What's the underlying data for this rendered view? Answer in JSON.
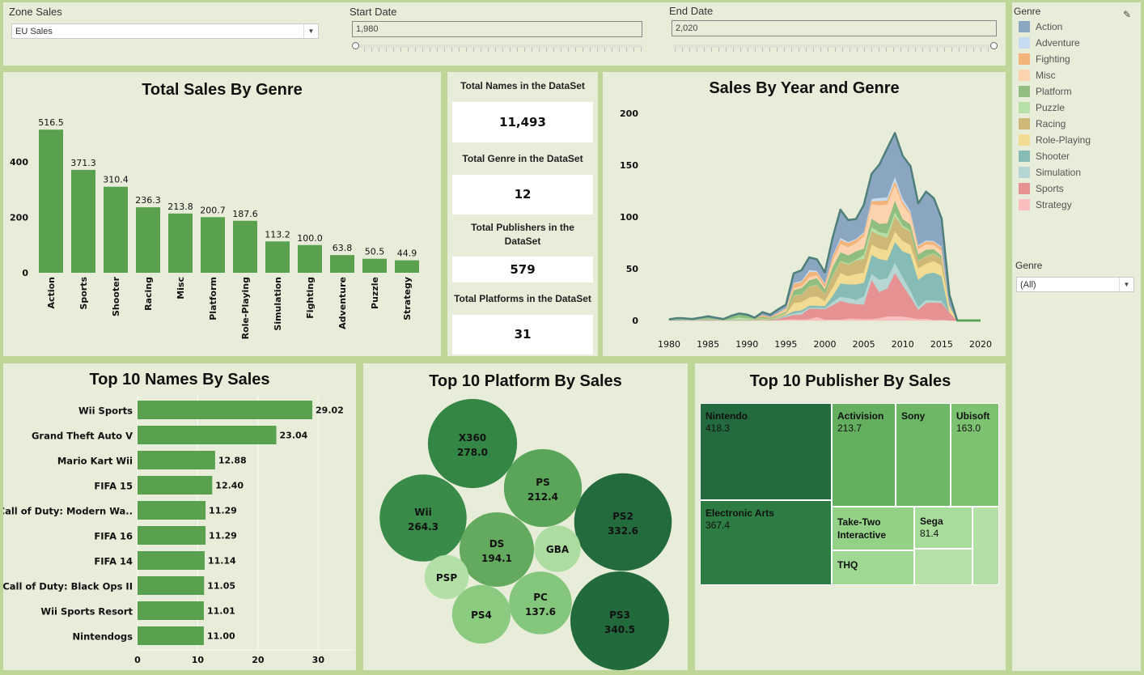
{
  "filters": {
    "zone_sales": {
      "label": "Zone Sales",
      "value": "EU Sales"
    },
    "start_date": {
      "label": "Start Date",
      "value": "1,980",
      "fraction": 0.0
    },
    "end_date": {
      "label": "End Date",
      "value": "2,020",
      "fraction": 1.0
    }
  },
  "legend": {
    "title": "Genre",
    "items": [
      {
        "label": "Action",
        "color": "#8aa6c1"
      },
      {
        "label": "Adventure",
        "color": "#c6dbef"
      },
      {
        "label": "Fighting",
        "color": "#f3b47a"
      },
      {
        "label": "Misc",
        "color": "#fdd3ad"
      },
      {
        "label": "Platform",
        "color": "#8fbe80"
      },
      {
        "label": "Puzzle",
        "color": "#b6e0a7"
      },
      {
        "label": "Racing",
        "color": "#cdb878"
      },
      {
        "label": "Role-Playing",
        "color": "#f2dc93"
      },
      {
        "label": "Shooter",
        "color": "#86bbb6"
      },
      {
        "label": "Simulation",
        "color": "#b5d6d3"
      },
      {
        "label": "Sports",
        "color": "#e69192"
      },
      {
        "label": "Strategy",
        "color": "#f9bebe"
      }
    ]
  },
  "genre_filter": {
    "label": "Genre",
    "value": "(All)"
  },
  "kpis": [
    {
      "label": "Total Names in the DataSet",
      "value": "11,493"
    },
    {
      "label": "Total Genre in the DataSet",
      "value": "12"
    },
    {
      "label": "Total Publishers in the DataSet",
      "value": "579"
    },
    {
      "label": "Total Platforms in the DataSet",
      "value": "31"
    }
  ],
  "chart_data": [
    {
      "id": "genre_bar",
      "type": "bar",
      "title": "Total Sales By Genre",
      "categories": [
        "Action",
        "Sports",
        "Shooter",
        "Racing",
        "Misc",
        "Platform",
        "Role-Playing",
        "Simulation",
        "Fighting",
        "Adventure",
        "Puzzle",
        "Strategy"
      ],
      "values": [
        516.5,
        371.3,
        310.4,
        236.3,
        213.8,
        200.7,
        187.6,
        113.2,
        100.0,
        63.8,
        50.5,
        44.9
      ],
      "labels": [
        "516.5",
        "371.3",
        "310.4",
        "236.3",
        "213.8",
        "200.7",
        "187.6",
        "113.2",
        "100.0",
        "63.8",
        "50.5",
        "44.9"
      ],
      "yticks": [
        0,
        200,
        400
      ],
      "ylim": [
        0,
        520
      ],
      "color": "#59a14f",
      "xlabel": "",
      "ylabel": ""
    },
    {
      "id": "year_area",
      "type": "area",
      "title": "Sales By Year and Genre",
      "x": [
        1980,
        1981,
        1982,
        1983,
        1984,
        1985,
        1986,
        1987,
        1988,
        1989,
        1990,
        1991,
        1992,
        1993,
        1994,
        1995,
        1996,
        1997,
        1998,
        1999,
        2000,
        2001,
        2002,
        2003,
        2004,
        2005,
        2006,
        2007,
        2008,
        2009,
        2010,
        2011,
        2012,
        2013,
        2014,
        2015,
        2016,
        2017,
        2018,
        2019,
        2020
      ],
      "series": [
        {
          "name": "Strategy",
          "values": [
            0,
            0,
            0,
            0,
            0,
            0,
            0,
            0,
            0,
            0,
            0,
            0.2,
            0.2,
            0,
            0.5,
            1,
            1.5,
            1,
            1.5,
            3.5,
            1,
            1,
            1,
            2,
            2,
            1.5,
            1.5,
            2.5,
            4,
            4,
            4,
            3,
            1.5,
            2,
            0.5,
            1,
            0,
            0,
            0,
            0,
            0
          ]
        },
        {
          "name": "Sports",
          "values": [
            0.2,
            0.3,
            0.3,
            0.3,
            0.4,
            0.4,
            0.4,
            0.2,
            0.3,
            0.5,
            0.3,
            0.3,
            0.3,
            0.3,
            1,
            2.5,
            4,
            5,
            10,
            8,
            10,
            14,
            18,
            15,
            14,
            14,
            38,
            25,
            27,
            42,
            30,
            20,
            9,
            15,
            17,
            16,
            8,
            0,
            0,
            0,
            0
          ]
        },
        {
          "name": "Simulation",
          "values": [
            0,
            0,
            0,
            0,
            0,
            0,
            0,
            0,
            0,
            0,
            0,
            0,
            0,
            0,
            0.5,
            1,
            1.5,
            2,
            1,
            1,
            1,
            3,
            4,
            5,
            4,
            8,
            6,
            12,
            10,
            10,
            8,
            6,
            3,
            3,
            2,
            2,
            0,
            0,
            0,
            0,
            0
          ]
        },
        {
          "name": "Shooter",
          "values": [
            0.5,
            0.8,
            0.5,
            0.2,
            0.5,
            0.5,
            0.3,
            0.2,
            0.3,
            0.3,
            0.2,
            0.3,
            0.3,
            0.3,
            0.5,
            1,
            2,
            2,
            2,
            2,
            2,
            6,
            13,
            13,
            15,
            13,
            18,
            20,
            17,
            20,
            25,
            35,
            26,
            25,
            27,
            24,
            0,
            0,
            0,
            0,
            0
          ]
        },
        {
          "name": "Role-Playing",
          "values": [
            0,
            0,
            0,
            0,
            0,
            0,
            0,
            0,
            0,
            0,
            0,
            0,
            0.5,
            0,
            0.5,
            1,
            8,
            8,
            8,
            9,
            5,
            8,
            10,
            8,
            10,
            10,
            10,
            10,
            10,
            10,
            10,
            9,
            11,
            10,
            11,
            10,
            7,
            0,
            0,
            0,
            0
          ]
        },
        {
          "name": "Racing",
          "values": [
            0,
            0,
            0,
            0,
            0.2,
            0.2,
            0.2,
            0,
            0,
            0,
            0.2,
            0.5,
            0.5,
            0.5,
            1,
            1,
            7,
            7,
            10,
            11,
            7,
            11,
            11,
            11,
            13,
            13,
            13,
            13,
            12,
            15,
            13,
            13,
            7,
            7,
            7,
            7,
            0,
            0,
            0,
            0,
            0
          ]
        },
        {
          "name": "Puzzle",
          "values": [
            0,
            0.3,
            0.3,
            0.2,
            0.3,
            0.5,
            0.3,
            0.2,
            1,
            2.5,
            1.5,
            0.5,
            0.5,
            0.5,
            0.5,
            0.5,
            0.5,
            0.5,
            0.5,
            0.5,
            0.5,
            1,
            1,
            1,
            1,
            4,
            4,
            3,
            4,
            4,
            2,
            1,
            0.5,
            0.5,
            0.5,
            0.5,
            0,
            0,
            0,
            0,
            0
          ]
        },
        {
          "name": "Platform",
          "values": [
            0,
            0.2,
            0.3,
            0.3,
            0.5,
            1.5,
            0.5,
            0.3,
            2.5,
            3,
            3,
            0.5,
            1.5,
            1,
            1,
            1,
            5,
            6,
            6,
            6,
            4,
            8,
            8,
            8,
            8,
            6,
            8,
            8,
            10,
            11,
            6,
            6,
            6,
            6,
            4,
            2,
            0,
            0,
            0,
            0,
            0
          ]
        },
        {
          "name": "Misc",
          "values": [
            0,
            0,
            0,
            0,
            0,
            0,
            0,
            0,
            0,
            0,
            0,
            0,
            0,
            0,
            1,
            2,
            2,
            2,
            3,
            3,
            2,
            6,
            8,
            8,
            8,
            12,
            14,
            18,
            18,
            15,
            14,
            9,
            5,
            5,
            4,
            5,
            0,
            0,
            0,
            0,
            0
          ]
        },
        {
          "name": "Fighting",
          "values": [
            0,
            0,
            0,
            0,
            0,
            0,
            0,
            0,
            0,
            0,
            0,
            0,
            1.5,
            1,
            1,
            1,
            4,
            4,
            5,
            3,
            3,
            4,
            4,
            4,
            3,
            3,
            3,
            4,
            4,
            4,
            3,
            2,
            3,
            3,
            3,
            3,
            0,
            0,
            0,
            0,
            0
          ]
        },
        {
          "name": "Adventure",
          "values": [
            0,
            0,
            0,
            0,
            0,
            0,
            0,
            0,
            0,
            0,
            0,
            0,
            0.3,
            0,
            0.3,
            0.3,
            1,
            1,
            2,
            1,
            1,
            1,
            2,
            1,
            1,
            1,
            2,
            3,
            3,
            4,
            3,
            2,
            1,
            1,
            1,
            1,
            0,
            0,
            0,
            0,
            0
          ]
        },
        {
          "name": "Action",
          "values": [
            0.5,
            0.7,
            0.7,
            0.5,
            0.8,
            1,
            1,
            0.5,
            0.5,
            0.5,
            0.5,
            0.5,
            2.5,
            2,
            3,
            3,
            9,
            10,
            12,
            11,
            10,
            17,
            27,
            21,
            19,
            26,
            24,
            32,
            47,
            42,
            41,
            43,
            40,
            47,
            41,
            27,
            10,
            0,
            0,
            0,
            0
          ]
        }
      ],
      "yticks": [
        0,
        50,
        100,
        150,
        200
      ],
      "xticks": [
        1980,
        1985,
        1990,
        1995,
        2000,
        2005,
        2010,
        2015,
        2020
      ],
      "ylim": [
        0,
        200
      ],
      "xlim": [
        1980,
        2020
      ],
      "outline_color": "#4e7f7a",
      "baseline_color": "#59a14f",
      "xlabel": "",
      "ylabel": ""
    },
    {
      "id": "names_bar",
      "type": "bar",
      "orientation": "horizontal",
      "title": "Top 10 Names By Sales",
      "categories": [
        "Wii Sports",
        "Grand Theft Auto V",
        "Mario Kart Wii",
        "FIFA 15",
        "Call of Duty: Modern Wa..",
        "FIFA 16",
        "FIFA 14",
        "Call of Duty: Black Ops II",
        "Wii Sports Resort",
        "Nintendogs"
      ],
      "values": [
        29.02,
        23.04,
        12.88,
        12.4,
        11.29,
        11.29,
        11.14,
        11.05,
        11.01,
        11.0
      ],
      "labels": [
        "29.02",
        "23.04",
        "12.88",
        "12.40",
        "11.29",
        "11.29",
        "11.14",
        "11.05",
        "11.01",
        "11.00"
      ],
      "xticks": [
        0,
        10,
        20,
        30
      ],
      "xlim": [
        0,
        36
      ],
      "color": "#59a14f",
      "grid": true,
      "xlabel": "",
      "ylabel": ""
    },
    {
      "id": "platform_bubble",
      "type": "bubble",
      "title": "Top 10 Platform By Sales",
      "items": [
        {
          "name": "PS3",
          "value": 340.5,
          "label": "340.5",
          "color": "#226a3c"
        },
        {
          "name": "PS2",
          "value": 332.6,
          "label": "332.6",
          "color": "#236b3d"
        },
        {
          "name": "X360",
          "value": 278.0,
          "label": "278.0",
          "color": "#348645"
        },
        {
          "name": "Wii",
          "value": 264.3,
          "label": "264.3",
          "color": "#388b48"
        },
        {
          "name": "PS",
          "value": 212.4,
          "label": "212.4",
          "color": "#5aa55a"
        },
        {
          "name": "DS",
          "value": 194.1,
          "label": "194.1",
          "color": "#64aa5e"
        },
        {
          "name": "PC",
          "value": 137.6,
          "label": "137.6",
          "color": "#84c67c"
        },
        {
          "name": "PS4",
          "value": 120,
          "label": "",
          "color": "#8acb80"
        },
        {
          "name": "GBA",
          "value": 75,
          "label": "",
          "color": "#acdca0"
        },
        {
          "name": "PSP",
          "value": 68,
          "label": "",
          "color": "#b2e0a6"
        }
      ]
    },
    {
      "id": "publisher_treemap",
      "type": "treemap",
      "title": "Top 10 Publisher By Sales",
      "items": [
        {
          "name": "Nintendo",
          "value": 418.3,
          "label": "418.3",
          "color": "#236a3e"
        },
        {
          "name": "Electronic Arts",
          "value": 367.4,
          "label": "367.4",
          "color": "#2c7c43"
        },
        {
          "name": "Activision",
          "value": 213.7,
          "label": "213.7",
          "color": "#65af60"
        },
        {
          "name": "Sony",
          "value": 177,
          "label": "",
          "color": "#6eb766"
        },
        {
          "name": "Ubisoft",
          "value": 163.0,
          "label": "163.0",
          "color": "#7cc270"
        },
        {
          "name": "Take-Two Interactive",
          "value": 100,
          "label": "",
          "color": "#92d186"
        },
        {
          "name": "THQ",
          "value": 80,
          "label": "",
          "color": "#9fd892"
        },
        {
          "name": "Sega",
          "value": 81.4,
          "label": "81.4",
          "color": "#a8dc9a"
        },
        {
          "name": "",
          "value": 55,
          "label": "",
          "color": "#b3e0a6"
        },
        {
          "name": "",
          "value": 50,
          "label": "",
          "color": "#b5e1a9"
        }
      ]
    }
  ]
}
